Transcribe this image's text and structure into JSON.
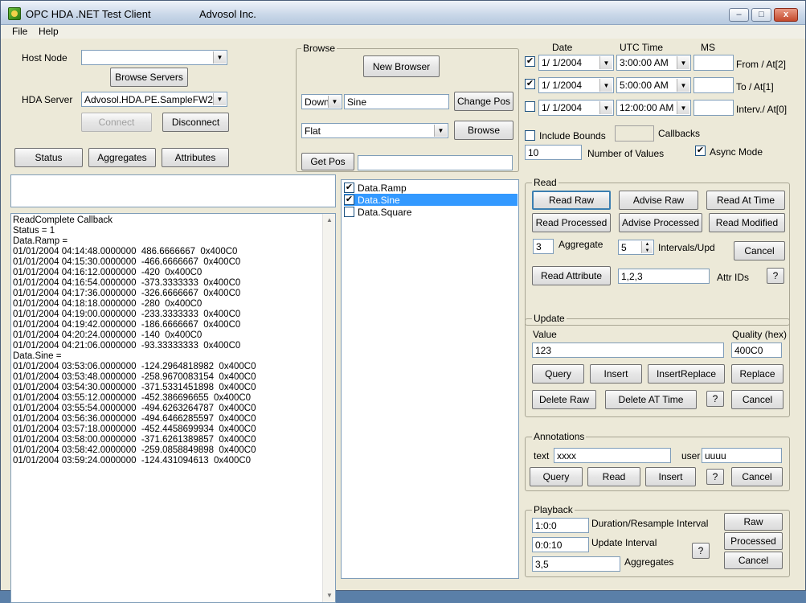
{
  "window": {
    "title": "OPC HDA .NET Test Client",
    "company": "Advosol Inc.",
    "minimize": "–",
    "maximize": "□",
    "close": "x"
  },
  "menu": {
    "file": "File",
    "help": "Help"
  },
  "connection": {
    "host_label": "Host Node",
    "host_value": "",
    "browse_servers": "Browse Servers",
    "server_label": "HDA Server",
    "server_value": "Advosol.HDA.PE.SampleFW2",
    "connect": "Connect",
    "disconnect": "Disconnect",
    "status": "Status",
    "aggregates": "Aggregates",
    "attributes": "Attributes"
  },
  "browse": {
    "title": "Browse",
    "new_browser": "New Browser",
    "direction": "Down",
    "position_value": "Sine",
    "change_pos": "Change Pos",
    "filter": "Flat",
    "browse_btn": "Browse",
    "get_pos": "Get Pos",
    "get_pos_value": ""
  },
  "log": {
    "header_value": "",
    "lines": "ReadComplete Callback\nStatus = 1\nData.Ramp =\n01/01/2004 04:14:48.0000000  486.6666667  0x400C0\n01/01/2004 04:15:30.0000000  -466.6666667  0x400C0\n01/01/2004 04:16:12.0000000  -420  0x400C0\n01/01/2004 04:16:54.0000000  -373.3333333  0x400C0\n01/01/2004 04:17:36.0000000  -326.6666667  0x400C0\n01/01/2004 04:18:18.0000000  -280  0x400C0\n01/01/2004 04:19:00.0000000  -233.3333333  0x400C0\n01/01/2004 04:19:42.0000000  -186.6666667  0x400C0\n01/01/2004 04:20:24.0000000  -140  0x400C0\n01/01/2004 04:21:06.0000000  -93.33333333  0x400C0\nData.Sine =\n01/01/2004 03:53:06.0000000  -124.2964818982  0x400C0\n01/01/2004 03:53:48.0000000  -258.9670083154  0x400C0\n01/01/2004 03:54:30.0000000  -371.5331451898  0x400C0\n01/01/2004 03:55:12.0000000  -452.386696655  0x400C0\n01/01/2004 03:55:54.0000000  -494.6263264787  0x400C0\n01/01/2004 03:56:36.0000000  -494.6466285597  0x400C0\n01/01/2004 03:57:18.0000000  -452.4458699934  0x400C0\n01/01/2004 03:58:00.0000000  -371.6261389857  0x400C0\n01/01/2004 03:58:42.0000000  -259.0858849898  0x400C0\n01/01/2004 03:59:24.0000000  -124.431094613  0x400C0"
  },
  "items": [
    {
      "label": "Data.Ramp",
      "checked": true,
      "mark": "✔"
    },
    {
      "label": "Data.Sine",
      "checked": true,
      "mark": "✔"
    },
    {
      "label": "Data.Square",
      "checked": false,
      "mark": ""
    }
  ],
  "time": {
    "date_header": "Date",
    "utc_header": "UTC  Time",
    "ms_header": "MS",
    "rows": [
      {
        "checked": true,
        "mark": "✔",
        "date": "1/  1/2004",
        "time": "3:00:00 AM",
        "ms": "",
        "label": "From  / At[2]"
      },
      {
        "checked": true,
        "mark": "✔",
        "date": "1/  1/2004",
        "time": "5:00:00 AM",
        "ms": "",
        "label": "To    /  At[1]"
      },
      {
        "checked": false,
        "mark": "",
        "date": "1/  1/2004",
        "time": "12:00:00 AM",
        "ms": "",
        "label": "Interv./ At[0]"
      }
    ],
    "include_bounds": "Include Bounds",
    "callbacks_value": "",
    "callbacks_label": "Callbacks",
    "num_values": "10",
    "num_values_label": "Number of Values",
    "async_mode": "Async Mode"
  },
  "read": {
    "title": "Read",
    "read_raw": "Read Raw",
    "advise_raw": "Advise Raw",
    "read_at_time": "Read At Time",
    "read_processed": "Read Processed",
    "advise_processed": "Advise Processed",
    "read_modified": "Read Modified",
    "aggregate_value": "3",
    "aggregate_label": "Aggregate",
    "intervals_value": "5",
    "intervals_label": "Intervals/Upd",
    "cancel": "Cancel",
    "read_attribute": "Read Attribute",
    "attr_ids_value": "1,2,3",
    "attr_ids_label": "Attr IDs",
    "help": "?"
  },
  "update": {
    "title": "Update",
    "value_label": "Value",
    "quality_label": "Quality (hex)",
    "value": "123",
    "quality": "400C0",
    "query": "Query",
    "insert": "Insert",
    "insert_replace": "InsertReplace",
    "replace": "Replace",
    "delete_raw": "Delete Raw",
    "delete_at_time": "Delete AT Time",
    "help": "?",
    "cancel": "Cancel"
  },
  "annotations": {
    "title": "Annotations",
    "text_label": "text",
    "text_value": "xxxx",
    "user_label": "user",
    "user_value": "uuuu",
    "query": "Query",
    "read": "Read",
    "insert": "Insert",
    "help": "?",
    "cancel": "Cancel"
  },
  "playback": {
    "title": "Playback",
    "duration_value": "1:0:0",
    "duration_label": "Duration/Resample Interval",
    "update_value": "0:0:10",
    "update_label": "Update Interval",
    "aggregates_value": "3,5",
    "aggregates_label": "Aggregates",
    "raw": "Raw",
    "processed": "Processed",
    "help": "?",
    "cancel": "Cancel"
  }
}
